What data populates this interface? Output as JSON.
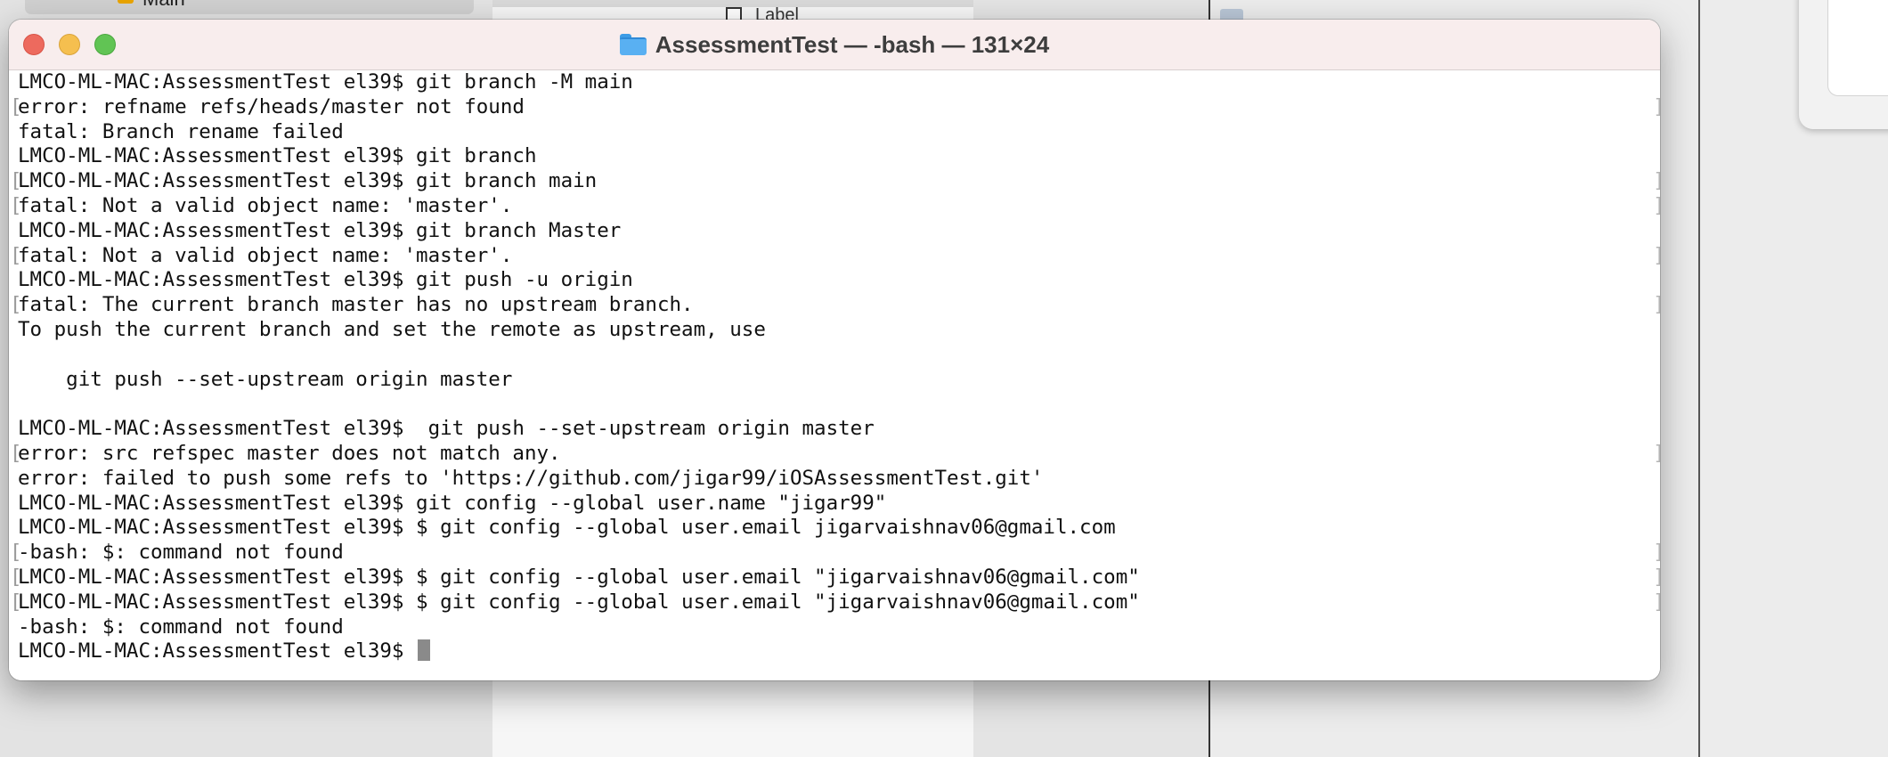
{
  "background": {
    "left_pill_label": "Main",
    "mid_label": "Label"
  },
  "terminal": {
    "title": "AssessmentTest — -bash — 131×24",
    "lines": [
      {
        "text": "LMCO-ML-MAC:AssessmentTest el39$ git branch -M main",
        "marked": false
      },
      {
        "text": "error: refname refs/heads/master not found",
        "marked": true
      },
      {
        "text": "fatal: Branch rename failed",
        "marked": false
      },
      {
        "text": "LMCO-ML-MAC:AssessmentTest el39$ git branch",
        "marked": false
      },
      {
        "text": "LMCO-ML-MAC:AssessmentTest el39$ git branch main",
        "marked": true
      },
      {
        "text": "fatal: Not a valid object name: 'master'.",
        "marked": true
      },
      {
        "text": "LMCO-ML-MAC:AssessmentTest el39$ git branch Master",
        "marked": false
      },
      {
        "text": "fatal: Not a valid object name: 'master'.",
        "marked": true
      },
      {
        "text": "LMCO-ML-MAC:AssessmentTest el39$ git push -u origin",
        "marked": false
      },
      {
        "text": "fatal: The current branch master has no upstream branch.",
        "marked": true
      },
      {
        "text": "To push the current branch and set the remote as upstream, use",
        "marked": false
      },
      {
        "text": "",
        "marked": false
      },
      {
        "text": "    git push --set-upstream origin master",
        "marked": false
      },
      {
        "text": "",
        "marked": false
      },
      {
        "text": "LMCO-ML-MAC:AssessmentTest el39$  git push --set-upstream origin master",
        "marked": false
      },
      {
        "text": "error: src refspec master does not match any.",
        "marked": true
      },
      {
        "text": "error: failed to push some refs to 'https://github.com/jigar99/iOSAssessmentTest.git'",
        "marked": false
      },
      {
        "text": "LMCO-ML-MAC:AssessmentTest el39$ git config --global user.name \"jigar99\"",
        "marked": false
      },
      {
        "text": "LMCO-ML-MAC:AssessmentTest el39$ $ git config --global user.email jigarvaishnav06@gmail.com",
        "marked": false
      },
      {
        "text": "-bash: $: command not found",
        "marked": true
      },
      {
        "text": "LMCO-ML-MAC:AssessmentTest el39$ $ git config --global user.email \"jigarvaishnav06@gmail.com\"",
        "marked": true
      },
      {
        "text": "LMCO-ML-MAC:AssessmentTest el39$ $ git config --global user.email \"jigarvaishnav06@gmail.com\"",
        "marked": true
      },
      {
        "text": "-bash: $: command not found",
        "marked": false
      },
      {
        "text": "LMCO-ML-MAC:AssessmentTest el39$ ",
        "marked": false,
        "cursor": true
      }
    ]
  },
  "icons": {
    "folder": "folder-icon",
    "close": "close-window-icon",
    "minimize": "minimize-window-icon",
    "zoom": "zoom-window-icon"
  },
  "colors": {
    "titlebar": "#f8eded",
    "close": "#ed6a5e",
    "minimize": "#f5bf4f",
    "zoom": "#61c454",
    "cursor": "#8a8a8a"
  }
}
